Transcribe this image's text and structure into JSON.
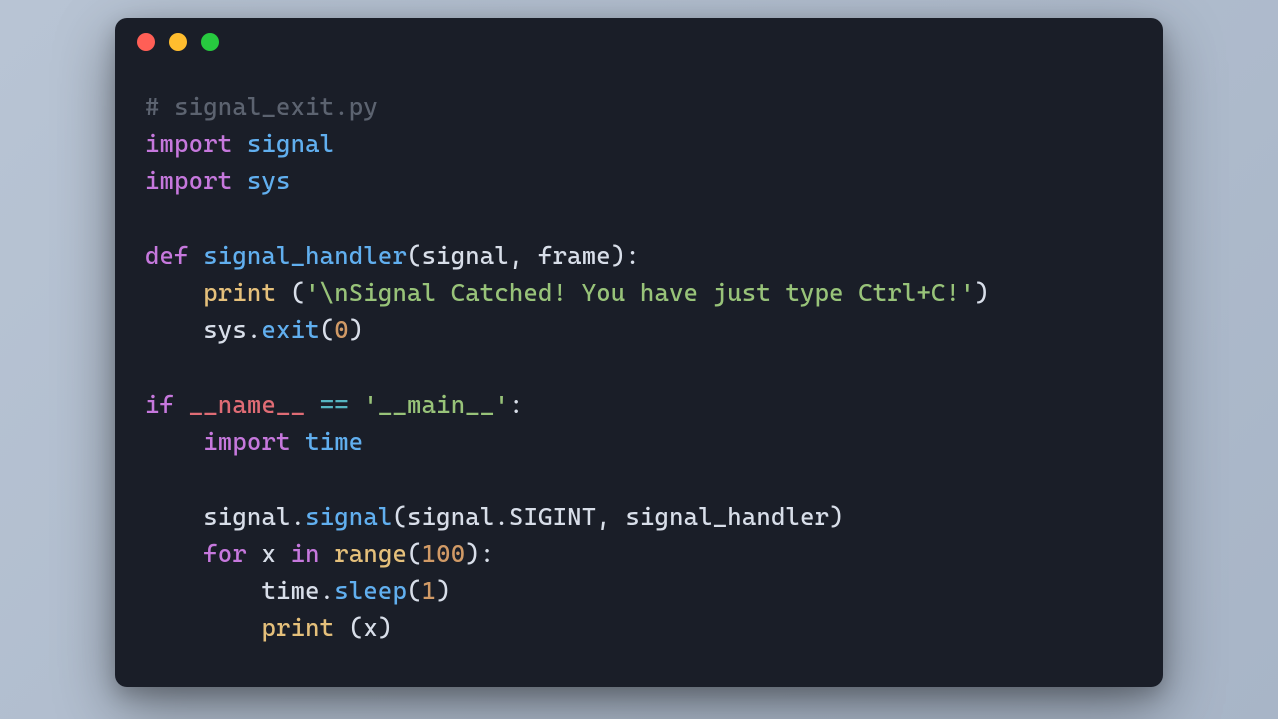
{
  "window": {
    "dot_colors": {
      "red": "#ff5f56",
      "yellow": "#ffbd2e",
      "green": "#27c93f"
    }
  },
  "code": {
    "lines": [
      [
        {
          "t": "# signal_exit.py",
          "c": "c-comment"
        }
      ],
      [
        {
          "t": "import",
          "c": "c-keyword"
        },
        {
          "t": " ",
          "c": "c-punct"
        },
        {
          "t": "signal",
          "c": "c-module"
        }
      ],
      [
        {
          "t": "import",
          "c": "c-keyword"
        },
        {
          "t": " ",
          "c": "c-punct"
        },
        {
          "t": "sys",
          "c": "c-module"
        }
      ],
      [],
      [
        {
          "t": "def",
          "c": "c-keyword"
        },
        {
          "t": " ",
          "c": "c-punct"
        },
        {
          "t": "signal_handler",
          "c": "c-func"
        },
        {
          "t": "(",
          "c": "c-punct"
        },
        {
          "t": "signal",
          "c": "c-param"
        },
        {
          "t": ", ",
          "c": "c-punct"
        },
        {
          "t": "frame",
          "c": "c-param"
        },
        {
          "t": "):",
          "c": "c-punct"
        }
      ],
      [
        {
          "t": "    ",
          "c": "c-punct"
        },
        {
          "t": "print",
          "c": "c-builtin"
        },
        {
          "t": " (",
          "c": "c-punct"
        },
        {
          "t": "'\\nSignal Catched! You have just type Ctrl+C!'",
          "c": "c-string"
        },
        {
          "t": ")",
          "c": "c-punct"
        }
      ],
      [
        {
          "t": "    ",
          "c": "c-punct"
        },
        {
          "t": "sys",
          "c": "c-var"
        },
        {
          "t": ".",
          "c": "c-punct"
        },
        {
          "t": "exit",
          "c": "c-call"
        },
        {
          "t": "(",
          "c": "c-punct"
        },
        {
          "t": "0",
          "c": "c-number"
        },
        {
          "t": ")",
          "c": "c-punct"
        }
      ],
      [],
      [
        {
          "t": "if",
          "c": "c-keyword"
        },
        {
          "t": " ",
          "c": "c-punct"
        },
        {
          "t": "__name__",
          "c": "c-dunder"
        },
        {
          "t": " ",
          "c": "c-punct"
        },
        {
          "t": "==",
          "c": "c-op"
        },
        {
          "t": " ",
          "c": "c-punct"
        },
        {
          "t": "'__main__'",
          "c": "c-string"
        },
        {
          "t": ":",
          "c": "c-punct"
        }
      ],
      [
        {
          "t": "    ",
          "c": "c-punct"
        },
        {
          "t": "import",
          "c": "c-keyword"
        },
        {
          "t": " ",
          "c": "c-punct"
        },
        {
          "t": "time",
          "c": "c-module"
        }
      ],
      [],
      [
        {
          "t": "    ",
          "c": "c-punct"
        },
        {
          "t": "signal",
          "c": "c-var"
        },
        {
          "t": ".",
          "c": "c-punct"
        },
        {
          "t": "signal",
          "c": "c-call"
        },
        {
          "t": "(",
          "c": "c-punct"
        },
        {
          "t": "signal",
          "c": "c-var"
        },
        {
          "t": ".",
          "c": "c-punct"
        },
        {
          "t": "SIGINT",
          "c": "c-const"
        },
        {
          "t": ", ",
          "c": "c-punct"
        },
        {
          "t": "signal_handler",
          "c": "c-var"
        },
        {
          "t": ")",
          "c": "c-punct"
        }
      ],
      [
        {
          "t": "    ",
          "c": "c-punct"
        },
        {
          "t": "for",
          "c": "c-for"
        },
        {
          "t": " ",
          "c": "c-punct"
        },
        {
          "t": "x",
          "c": "c-var"
        },
        {
          "t": " ",
          "c": "c-punct"
        },
        {
          "t": "in",
          "c": "c-keyword"
        },
        {
          "t": " ",
          "c": "c-punct"
        },
        {
          "t": "range",
          "c": "c-builtin"
        },
        {
          "t": "(",
          "c": "c-punct"
        },
        {
          "t": "100",
          "c": "c-number"
        },
        {
          "t": "):",
          "c": "c-punct"
        }
      ],
      [
        {
          "t": "        ",
          "c": "c-punct"
        },
        {
          "t": "time",
          "c": "c-var"
        },
        {
          "t": ".",
          "c": "c-punct"
        },
        {
          "t": "sleep",
          "c": "c-call"
        },
        {
          "t": "(",
          "c": "c-punct"
        },
        {
          "t": "1",
          "c": "c-number"
        },
        {
          "t": ")",
          "c": "c-punct"
        }
      ],
      [
        {
          "t": "        ",
          "c": "c-punct"
        },
        {
          "t": "print",
          "c": "c-builtin"
        },
        {
          "t": " (",
          "c": "c-punct"
        },
        {
          "t": "x",
          "c": "c-var"
        },
        {
          "t": ")",
          "c": "c-punct"
        }
      ]
    ]
  }
}
